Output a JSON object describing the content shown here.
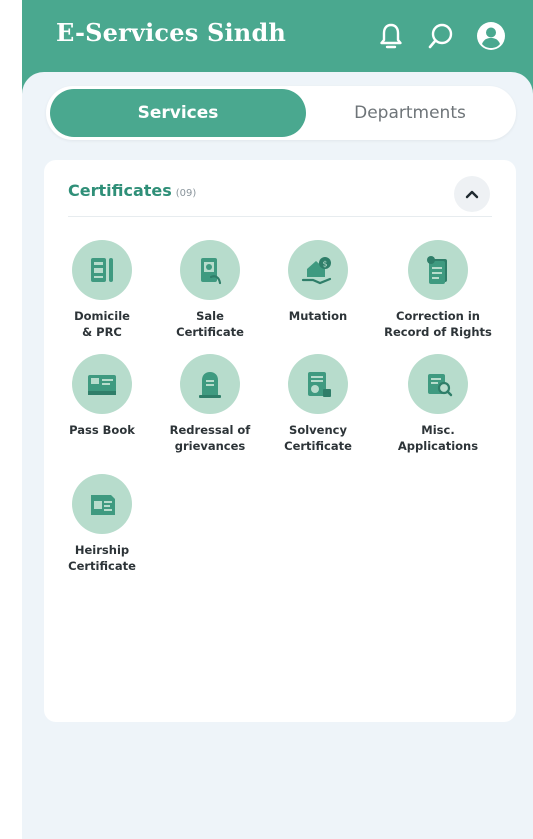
{
  "header": {
    "title": "E-Services Sindh",
    "icons": [
      "bell-icon",
      "search-icon",
      "account-icon"
    ]
  },
  "tabs": [
    {
      "label": "Services",
      "active": true
    },
    {
      "label": "Departments",
      "active": false
    }
  ],
  "section": {
    "title": "Certificates",
    "count": "(09)",
    "expanded": true
  },
  "services": [
    {
      "label": "Domicile\n& PRC",
      "icon": "domicile-icon"
    },
    {
      "label": "Sale\nCertificate",
      "icon": "sale-certificate-icon"
    },
    {
      "label": "Mutation",
      "icon": "mutation-icon"
    },
    {
      "label": "Correction in\nRecord of Rights",
      "icon": "correction-icon"
    },
    {
      "label": "Pass Book",
      "icon": "pass-book-icon"
    },
    {
      "label": "Redressal of\ngrievances",
      "icon": "redressal-icon"
    },
    {
      "label": "Solvency\nCertificate",
      "icon": "solvency-icon"
    },
    {
      "label": "Misc.\nApplications",
      "icon": "misc-applications-icon"
    },
    {
      "label": "Heirship\nCertificate",
      "icon": "heirship-icon"
    }
  ],
  "colors": {
    "brand": "#4aa88f",
    "icon_bg": "#b7dccc",
    "icon_fg": "#3f9a80",
    "page_bg": "#eef4f9"
  }
}
